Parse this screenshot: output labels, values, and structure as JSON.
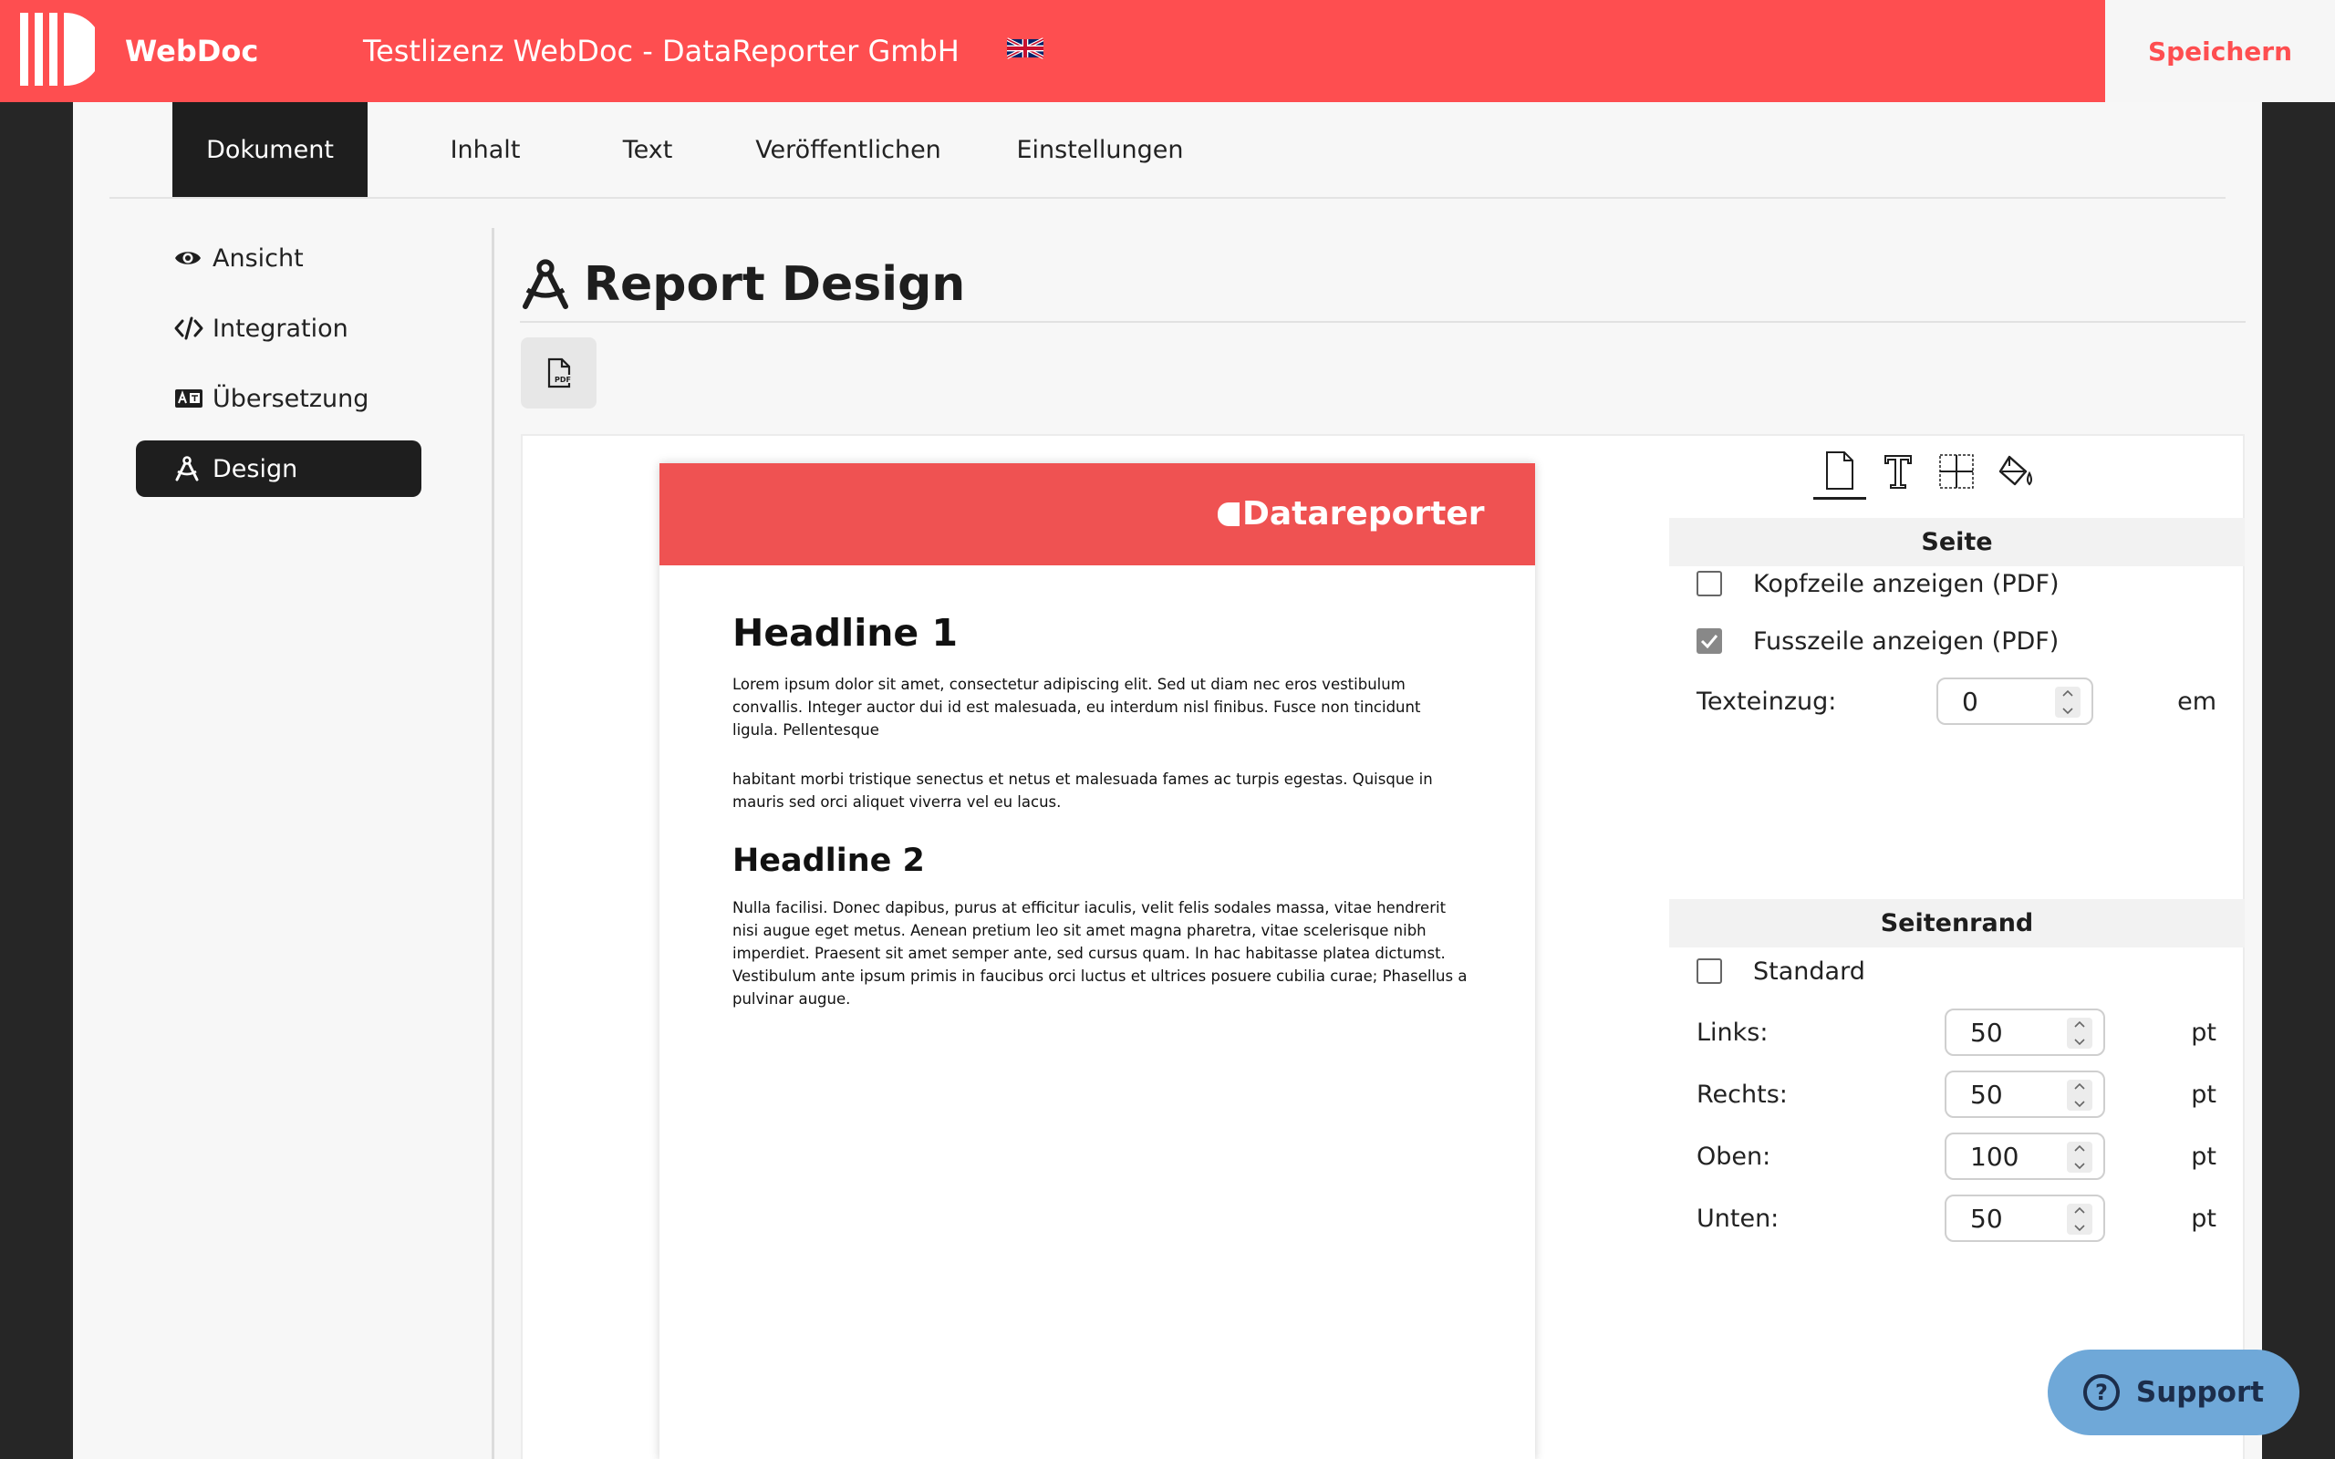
{
  "header": {
    "app_name": "WebDoc",
    "license": "Testlizenz WebDoc - DataReporter GmbH",
    "language_flag": "uk-flag-icon",
    "save_label": "Speichern",
    "accent_color": "#fe4e50"
  },
  "tabs": [
    {
      "label": "Dokument",
      "active": true
    },
    {
      "label": "Inhalt"
    },
    {
      "label": "Text"
    },
    {
      "label": "Veröffentlichen"
    },
    {
      "label": "Einstellungen"
    }
  ],
  "sidebar": {
    "items": [
      {
        "label": "Ansicht",
        "icon": "eye-icon"
      },
      {
        "label": "Integration",
        "icon": "code-icon"
      },
      {
        "label": "Übersetzung",
        "icon": "translate-icon"
      },
      {
        "label": "Design",
        "icon": "compass-icon",
        "active": true
      }
    ]
  },
  "page": {
    "title": "Report Design",
    "pdf_button_icon": "pdf-file-icon"
  },
  "preview": {
    "brand": "Datareporter",
    "header_color": "#ef5252",
    "headline1": "Headline 1",
    "paragraph1": "Lorem ipsum dolor sit amet, consectetur adipiscing elit. Sed ut diam nec eros vestibulum convallis. Integer auctor dui id est malesuada, eu interdum nisl finibus. Fusce non tincidunt ligula. Pellentesque",
    "paragraph2": "habitant morbi tristique senectus et netus et malesuada fames ac turpis egestas. Quisque in mauris sed orci aliquet viverra vel eu lacus.",
    "headline2": "Headline 2",
    "paragraph3": "Nulla facilisi. Donec dapibus, purus at efficitur iaculis, velit felis sodales massa, vitae hendrerit nisi augue eget metus. Aenean pretium leo sit amet magna pharetra, vitae scelerisque nibh imperdiet. Praesent sit amet semper ante, sed cursus quam. In hac habitasse platea dictumst. Vestibulum ante ipsum primis in faucibus orci luctus et ultrices posuere cubilia curae; Phasellus a pulvinar augue."
  },
  "settings": {
    "tabs": [
      {
        "icon": "page-icon",
        "active": true
      },
      {
        "icon": "text-icon"
      },
      {
        "icon": "grid-icon"
      },
      {
        "icon": "paint-bucket-icon"
      }
    ],
    "page_section": {
      "title": "Seite",
      "show_header_label": "Kopfzeile anzeigen (PDF)",
      "show_header_checked": false,
      "show_footer_label": "Fusszeile anzeigen (PDF)",
      "show_footer_checked": true,
      "indent_label": "Texteinzug:",
      "indent_value": "0",
      "indent_unit": "em"
    },
    "margin_section": {
      "title": "Seitenrand",
      "standard_label": "Standard",
      "standard_checked": false,
      "left_label": "Links:",
      "left_value": "50",
      "right_label": "Rechts:",
      "right_value": "50",
      "top_label": "Oben:",
      "top_value": "100",
      "bottom_label": "Unten:",
      "bottom_value": "50",
      "unit": "pt"
    }
  },
  "support": {
    "label": "Support"
  }
}
